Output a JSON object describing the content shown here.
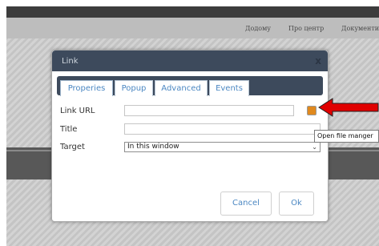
{
  "background_page": {
    "nav_items": [
      "Додому",
      "Про центр",
      "Документи"
    ]
  },
  "dialog": {
    "title": "Link",
    "close_label": "x",
    "tabs": [
      {
        "label": "Properies",
        "active": true
      },
      {
        "label": "Popup",
        "active": false
      },
      {
        "label": "Advanced",
        "active": false
      },
      {
        "label": "Events",
        "active": false
      }
    ],
    "fields": {
      "link_url": {
        "label": "Link URL",
        "value": ""
      },
      "title": {
        "label": "Title",
        "value": ""
      },
      "target": {
        "label": "Target",
        "value": "In this window"
      }
    },
    "buttons": {
      "cancel": "Cancel",
      "ok": "Ok"
    }
  },
  "tooltip": {
    "text": "Open file manger"
  },
  "colors": {
    "dialog_header": "#3d4a5c",
    "accent_link": "#4b87c2",
    "file_button": "#e0891e",
    "arrow": "#e00000"
  },
  "icons": {
    "file_button": "folder-icon",
    "annotation": "arrow-icon"
  }
}
